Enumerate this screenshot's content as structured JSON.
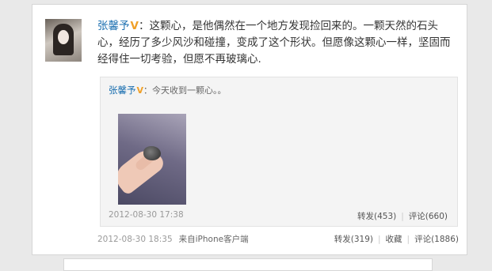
{
  "post": {
    "author": "张馨予",
    "verified_badge": "V",
    "colon": "：",
    "text": "这颗心，是他偶然在一个地方发现捡回来的。一颗天然的石头心，经历了多少风沙和碰撞，变成了这个形状。但愿像这颗心一样，坚固而经得住一切考验，但愿不再玻璃心.",
    "timestamp": "2012-08-30 18:35",
    "source": "来自iPhone客户端",
    "actions": {
      "repost": "转发(319)",
      "favorite": "收藏",
      "comment": "评论(1886)"
    }
  },
  "repost": {
    "author": "张馨予",
    "verified_badge": "V",
    "text": "：今天收到一颗心。。",
    "timestamp": "2012-08-30 17:38",
    "actions": {
      "repost": "转发(453)",
      "comment": "评论(660)"
    }
  },
  "separator": "|"
}
